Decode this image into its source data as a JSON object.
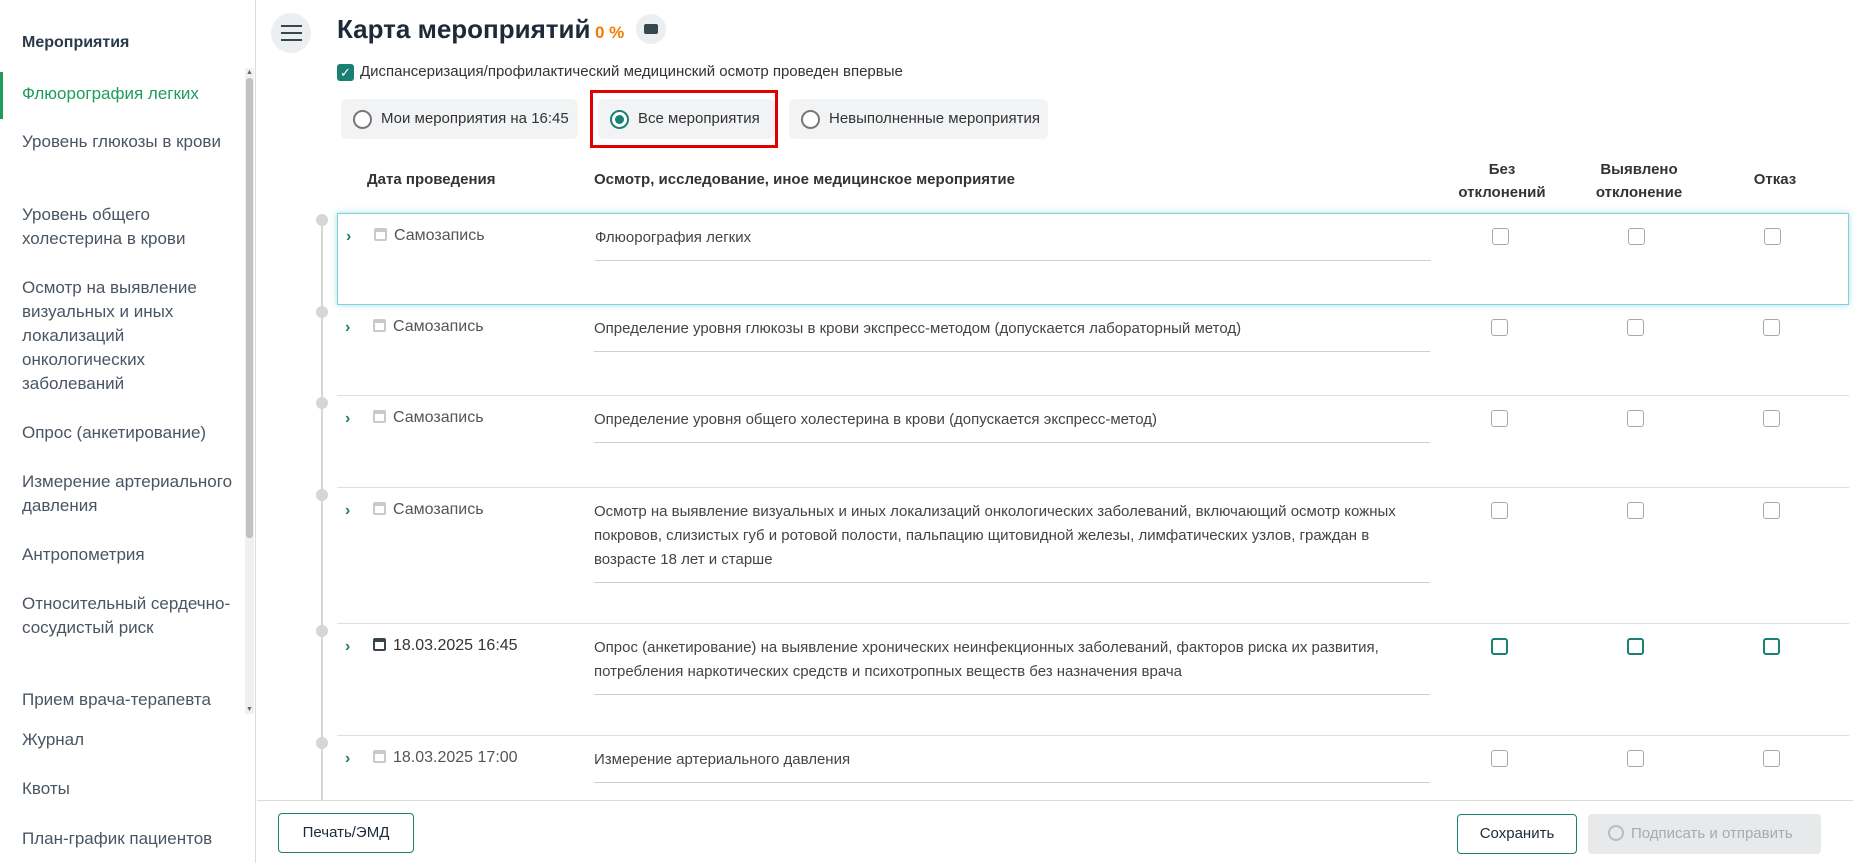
{
  "sidebar": {
    "title": "Мероприятия",
    "items": [
      {
        "label": "Флюорография легких"
      },
      {
        "label": "Уровень глюкозы в крови"
      },
      {
        "label": "Уровень общего холестерина в крови"
      },
      {
        "label": "Осмотр на выявление визуальных и иных локализаций онкологических заболеваний"
      },
      {
        "label": "Опрос (анкетирование)"
      },
      {
        "label": "Измерение артериального давления"
      },
      {
        "label": "Антропометрия"
      },
      {
        "label": "Относительный сердечно-сосудистый риск"
      },
      {
        "label": "Прием врача-терапевта"
      }
    ],
    "bottom": [
      {
        "label": "Журнал"
      },
      {
        "label": "Квоты"
      },
      {
        "label": "План-график пациентов"
      }
    ]
  },
  "header": {
    "title": "Карта мероприятий",
    "progress": "0 %",
    "first_time_label": "Диспансеризация/профилактический медицинский осмотр проведен впервые"
  },
  "filters": [
    {
      "label": "Мои мероприятия на 16:45",
      "selected": false
    },
    {
      "label": "Все мероприятия",
      "selected": true
    },
    {
      "label": "Невыполненные мероприятия",
      "selected": false
    }
  ],
  "table": {
    "columns": {
      "date": "Дата проведения",
      "event": "Осмотр, исследование, иное медицинское мероприятие",
      "no_dev_1": "Без",
      "no_dev_2": "отклонений",
      "dev_1": "Выявлено",
      "dev_2": "отклонение",
      "refuse": "Отказ"
    },
    "rows": [
      {
        "date": "Самозапись",
        "description": "Флюорография легких"
      },
      {
        "date": "Самозапись",
        "description": "Определение уровня глюкозы в крови экспресс-методом (допускается лабораторный метод)"
      },
      {
        "date": "Самозапись",
        "description": "Определение уровня общего холестерина в крови (допускается экспресс-метод)"
      },
      {
        "date": "Самозапись",
        "description": "Осмотр на выявление визуальных и иных локализаций онкологических заболеваний, включающий осмотр кожных покровов, слизистых губ и ротовой полости, пальпацию щитовидной железы, лимфатических узлов, граждан в возрасте 18 лет и старше"
      },
      {
        "date": "18.03.2025 16:45",
        "description": "Опрос (анкетирование) на выявление хронических неинфекционных заболеваний, факторов риска их развития, потребления наркотических средств и психотропных веществ без назначения врача"
      },
      {
        "date": "18.03.2025 17:00",
        "description": "Измерение артериального давления"
      }
    ]
  },
  "footer": {
    "print_label": "Печать/ЭМД",
    "save_label": "Сохранить",
    "sign_label": "Подписать и отправить"
  },
  "colors": {
    "accent": "#1b7f74",
    "active_nav": "#1f9c5c",
    "progress": "#f57c00",
    "highlight": "#e00000"
  }
}
